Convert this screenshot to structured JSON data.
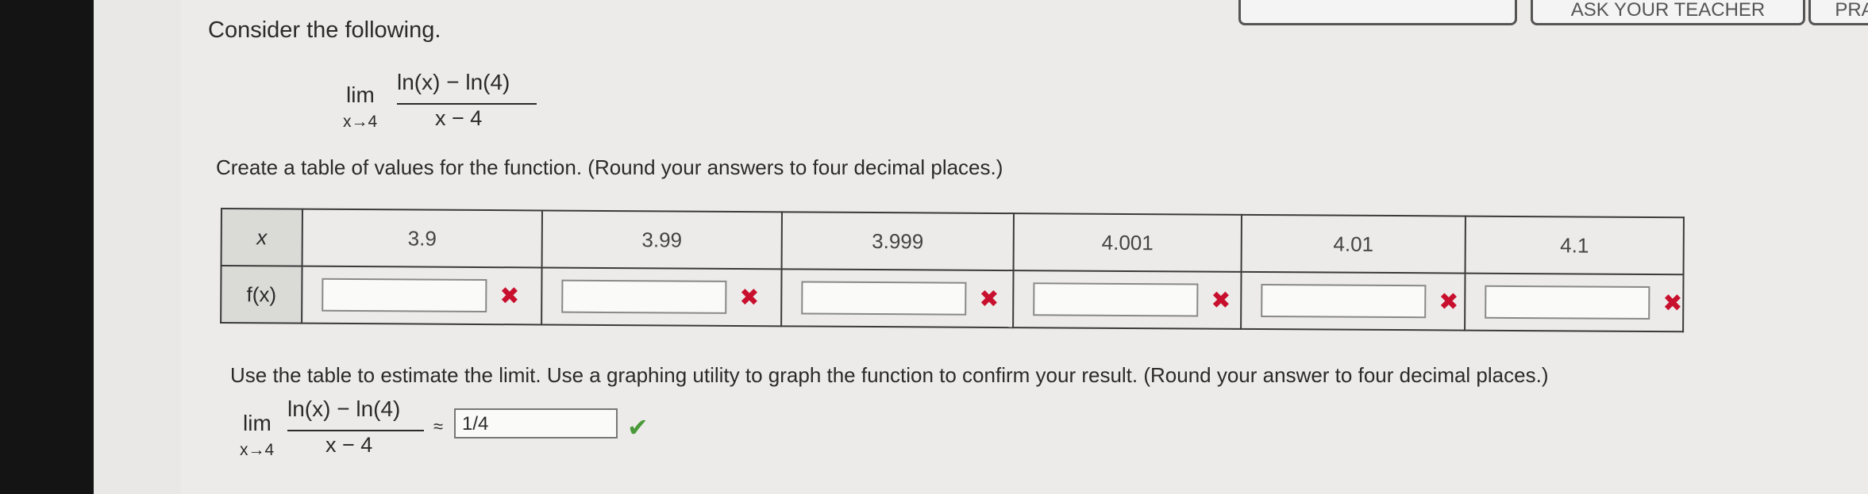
{
  "top_buttons": [
    {
      "label": ""
    },
    {
      "label": "ASK YOUR TEACHER"
    },
    {
      "label": "PRA"
    }
  ],
  "problem": {
    "heading": "Consider the following.",
    "lim_word": "lim",
    "lim_sub": "x→4",
    "numerator": "ln(x) − ln(4)",
    "denominator": "x − 4"
  },
  "table_instruction": "Create a table of values for the function. (Round your answers to four decimal places.)",
  "table": {
    "x_header": "x",
    "fx_header": "f(x)",
    "x_values": [
      "3.9",
      "3.99",
      "3.999",
      "4.001",
      "4.01",
      "4.1"
    ],
    "f_values": [
      "",
      "",
      "",
      "",
      "",
      ""
    ],
    "status_icon": "✖"
  },
  "estimate_instruction": "Use the table to estimate the limit. Use a graphing utility to graph the function to confirm your result. (Round your answer to four decimal places.)",
  "estimate": {
    "approx_symbol": "≈",
    "answer": "1/4",
    "check_icon": "✔"
  },
  "colors": {
    "incorrect": "#c8102e",
    "correct": "#4a9a3a"
  }
}
